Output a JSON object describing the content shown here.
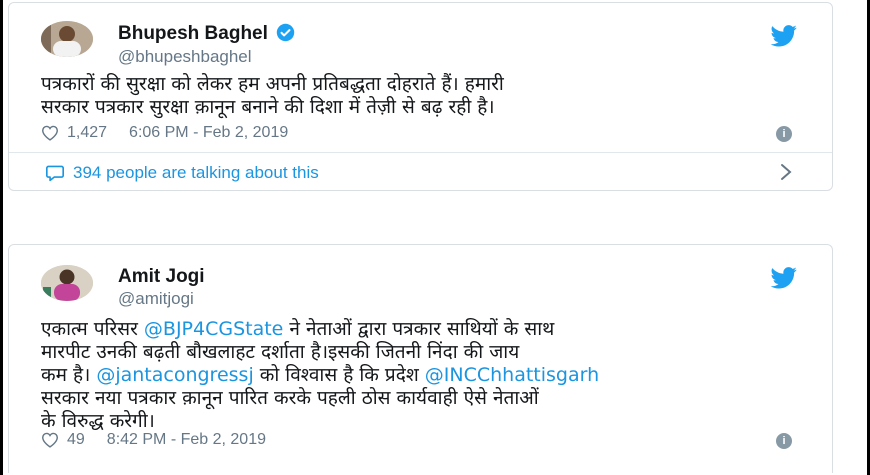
{
  "tweets": [
    {
      "name": "Bhupesh Baghel",
      "handle": "@bhupeshbaghel",
      "verified": true,
      "text_lines": [
        "पत्रकारों की सुरक्षा को लेकर हम अपनी प्रतिबद्धता दोहराते हैं। हमारी",
        "सरकार पत्रकार सुरक्षा क़ानून बनाने की दिशा में तेज़ी से बढ़ रही है।"
      ],
      "likes": "1,427",
      "timestamp": "6:06 PM - Feb 2, 2019",
      "talking": "394 people are talking about this"
    },
    {
      "name": "Amit Jogi",
      "handle": "@amitjogi",
      "text": {
        "l1_a": "एकात्म परिसर ",
        "l1_mention": "@BJP4CGState",
        "l1_b": " ने नेताओं द्वारा पत्रकार साथियों के साथ",
        "l2": "मारपीट उनकी बढ़ती बौखलाहट दर्शाता है।इसकी जितनी निंदा की जाय",
        "l3": "कम है। ",
        "l3_mention": "@jantacongressj",
        "l3_b": " को विश्वास है कि प्रदेश ",
        "l3_mention2": "@INCChhattisgarh",
        "l4": "सरकार नया पत्रकार क़ानून पारित करके पहली ठोस कार्यवाही ऐसे नेताओं",
        "l5": "के विरुद्ध करेगी।"
      },
      "likes": "49",
      "timestamp": "8:42 PM - Feb 2, 2019"
    }
  ],
  "icons": {
    "twitter_bird": "twitter-bird-icon",
    "verified": "verified-badge-icon",
    "like": "heart-icon",
    "info": "info-icon",
    "reply_bubble": "speech-bubble-icon",
    "chevron": "chevron-right-icon"
  },
  "colors": {
    "twitter_blue": "#1da1f2",
    "link_blue": "#1b95e0",
    "text": "#14171a",
    "muted": "#657786"
  }
}
